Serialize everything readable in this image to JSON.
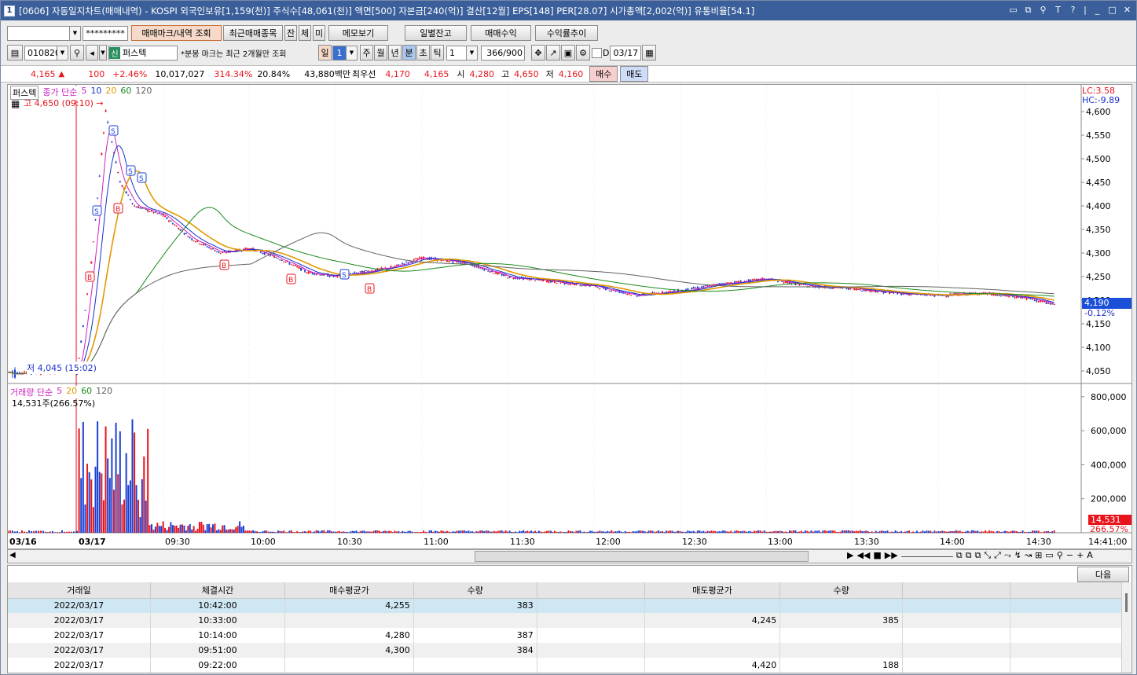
{
  "titlebar": {
    "badge": "1",
    "title": "[0606] 자동일지차트(매매내역) - KOSPI 외국인보유[1,159(천)] 주식수[48,061(천)] 액면[500] 자본금[240(억)] 결산[12월] EPS[148] PER[28.07] 시가총액[2,002(억)] 유통비율[54.1]",
    "icons": [
      "layout-icon",
      "restore-icon",
      "pin-icon",
      "font-icon",
      "help-icon",
      "minimize-icon",
      "maximize-icon",
      "close-icon"
    ]
  },
  "toolbar1": {
    "account": "",
    "password": "*********",
    "buttons": [
      "매매마크/내역 조회",
      "최근매매종목",
      "잔",
      "체",
      "미",
      "메모보기"
    ],
    "right_buttons": [
      "일별잔고",
      "매매수익",
      "수익률추이"
    ]
  },
  "toolbar2": {
    "code": "010820",
    "badge": "신",
    "name": "퍼스텍",
    "note": "*분봉 마크는 최근 2개월만 조회",
    "periods": [
      "일",
      "주",
      "월",
      "년",
      "분",
      "초",
      "틱"
    ],
    "period_value": "1",
    "interval": "1",
    "count": "366",
    "count_max": "/900",
    "date": "03/17",
    "d_label": "D"
  },
  "quote": {
    "price": "4,165",
    "change": "100",
    "pct": "+2.46%",
    "volume": "10,017,027",
    "vol_ratio": "314.34%",
    "turnover": "20.84%",
    "amount": "43,880백만",
    "best_label": "최우선",
    "ask": "4,170",
    "bid": "4,165",
    "open_label": "시",
    "open": "4,280",
    "high_label": "고",
    "high": "4,650",
    "low_label": "저",
    "low": "4,160",
    "buy": "매수",
    "sell": "매도"
  },
  "price_chart": {
    "legend": "종가 단순",
    "ma_periods": [
      "5",
      "10",
      "20",
      "60",
      "120"
    ],
    "name_tag": "퍼스텍",
    "high_note": "고 4,650 (09:10) →",
    "low_note": "저 4,045 (15:02)",
    "lc": "LC:3.58",
    "hc": "HC:-9.89",
    "current": "4,190",
    "current_pct": "-0.12%",
    "y_ticks": [
      "4,600",
      "4,550",
      "4,500",
      "4,450",
      "4,400",
      "4,350",
      "4,300",
      "4,250",
      "4,200",
      "4,150",
      "4,100",
      "4,050"
    ]
  },
  "volume_chart": {
    "legend": "거래량 단순",
    "ma_periods": [
      "5",
      "20",
      "60",
      "120"
    ],
    "info": "14,531주(266.57%)",
    "y_ticks": [
      "800,000",
      "600,000",
      "400,000",
      "200,000"
    ],
    "current": "14,531",
    "current_pct": "266.57%"
  },
  "x_axis": {
    "ticks": [
      "03/16",
      "03/17",
      "09:30",
      "10:00",
      "10:30",
      "11:00",
      "11:30",
      "12:00",
      "12:30",
      "13:00",
      "13:30",
      "14:00",
      "14:30"
    ],
    "end": "14:41:00"
  },
  "table": {
    "next_button": "다음",
    "headers": [
      "거래일",
      "체결시간",
      "매수평균가",
      "수량",
      "",
      "매도평균가",
      "수량",
      "",
      ""
    ],
    "rows": [
      [
        "2022/03/17",
        "10:42:00",
        "4,255",
        "383",
        "",
        "",
        "",
        "",
        ""
      ],
      [
        "2022/03/17",
        "10:33:00",
        "",
        "",
        "",
        "4,245",
        "385",
        "",
        ""
      ],
      [
        "2022/03/17",
        "10:14:00",
        "4,280",
        "387",
        "",
        "",
        "",
        "",
        ""
      ],
      [
        "2022/03/17",
        "09:51:00",
        "4,300",
        "384",
        "",
        "",
        "",
        "",
        ""
      ],
      [
        "2022/03/17",
        "09:22:00",
        "",
        "",
        "",
        "4,420",
        "188",
        "",
        ""
      ]
    ]
  },
  "colors": {
    "up": "#e8141c",
    "down": "#1a3fd4",
    "ma5": "#d020c0",
    "ma10": "#1a30c8",
    "ma20": "#e09a00",
    "ma60": "#1a8a1a",
    "ma120": "#606060",
    "title": "#3a5f9a"
  },
  "chart_data": {
    "type": "candlestick",
    "series": [
      {
        "time": "09:00",
        "value": 4045
      },
      {
        "time": "09:05",
        "value": 4280
      },
      {
        "time": "09:10",
        "value": 4600
      },
      {
        "time": "09:15",
        "value": 4450
      },
      {
        "time": "09:20",
        "value": 4400
      },
      {
        "time": "09:30",
        "value": 4380
      },
      {
        "time": "09:40",
        "value": 4330
      },
      {
        "time": "09:50",
        "value": 4300
      },
      {
        "time": "10:00",
        "value": 4310
      },
      {
        "time": "10:10",
        "value": 4290
      },
      {
        "time": "10:20",
        "value": 4260
      },
      {
        "time": "10:30",
        "value": 4250
      },
      {
        "time": "10:40",
        "value": 4260
      },
      {
        "time": "10:50",
        "value": 4270
      },
      {
        "time": "11:00",
        "value": 4290
      },
      {
        "time": "11:15",
        "value": 4280
      },
      {
        "time": "11:30",
        "value": 4250
      },
      {
        "time": "11:45",
        "value": 4240
      },
      {
        "time": "12:00",
        "value": 4230
      },
      {
        "time": "12:15",
        "value": 4210
      },
      {
        "time": "12:30",
        "value": 4220
      },
      {
        "time": "12:45",
        "value": 4235
      },
      {
        "time": "13:00",
        "value": 4245
      },
      {
        "time": "13:15",
        "value": 4230
      },
      {
        "time": "13:30",
        "value": 4225
      },
      {
        "time": "13:45",
        "value": 4215
      },
      {
        "time": "14:00",
        "value": 4210
      },
      {
        "time": "14:15",
        "value": 4215
      },
      {
        "time": "14:30",
        "value": 4205
      },
      {
        "time": "14:41",
        "value": 4190
      }
    ],
    "ylim": [
      4030,
      4650
    ]
  }
}
